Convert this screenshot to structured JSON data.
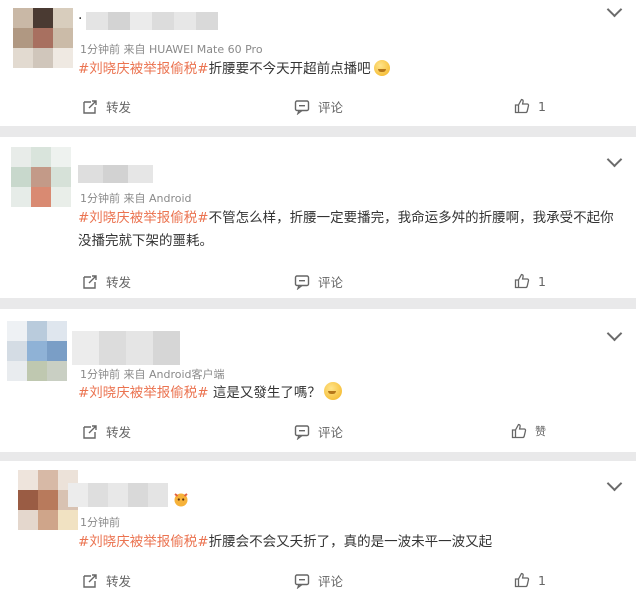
{
  "actions": {
    "repost": "转发",
    "comment": "评论"
  },
  "posts": [
    {
      "username_prefix": "·",
      "meta": "1分钟前  来自 HUAWEI Mate 60 Pro",
      "hashtag": "#刘晓庆被举报偷税#",
      "text": "折腰要不今天开超前点播吧",
      "emoji": "smile-emoji",
      "like_count": "1"
    },
    {
      "meta": "1分钟前  来自 Android",
      "hashtag": "#刘晓庆被举报偷税#",
      "text": "不管怎么样，折腰一定要播完，我命运多舛的折腰啊，我承受不起你没播完就下架的噩耗。",
      "like_count": "1"
    },
    {
      "meta": "1分钟前  来自 Android客户端",
      "hashtag": "#刘晓庆被举报偷税#",
      "text": " 這是又發生了嗎？",
      "emoji": "surprised-emoji",
      "like_count": "赞"
    },
    {
      "meta": "1分钟前",
      "hashtag": "#刘晓庆被举报偷税#",
      "text": "折腰会不会又夭折了，真的是一波未平一波又起",
      "badge_icon": "fan-badge-icon",
      "like_count": "1"
    }
  ],
  "colors": {
    "hashtag": "#eb7350",
    "text": "#333333",
    "meta": "#8a8a8a",
    "separator": "#e9e9ea"
  }
}
